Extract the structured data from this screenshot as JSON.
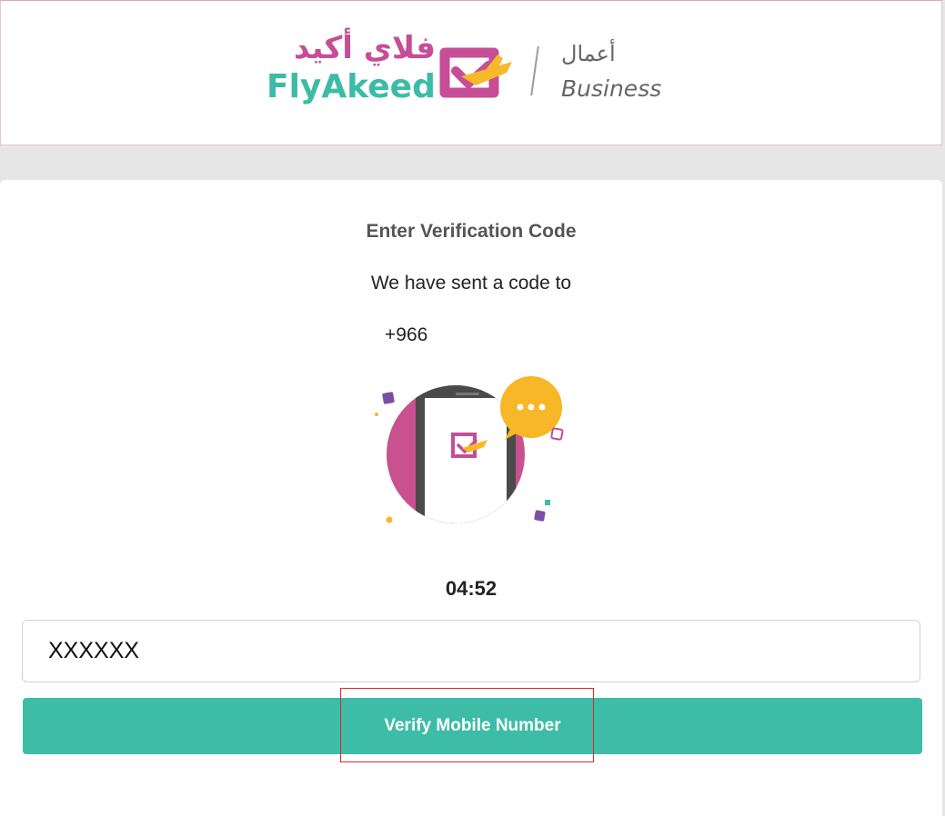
{
  "brand": {
    "arabic_name": "فلاي أكيد",
    "english_name": "FlyAkeed",
    "business_ar": "أعمال",
    "business_en": "Business",
    "colors": {
      "pink": "#c64d96",
      "teal": "#3cbca6",
      "yellow": "#f5b92a"
    }
  },
  "verification": {
    "title": "Enter Verification Code",
    "sent_message": "We have sent a code to",
    "phone_number": "+966",
    "timer": "04:52"
  },
  "code_input": {
    "value": "XXXXXX",
    "placeholder": ""
  },
  "verify_button": {
    "label": "Verify Mobile Number",
    "color": "#3dbca6"
  }
}
